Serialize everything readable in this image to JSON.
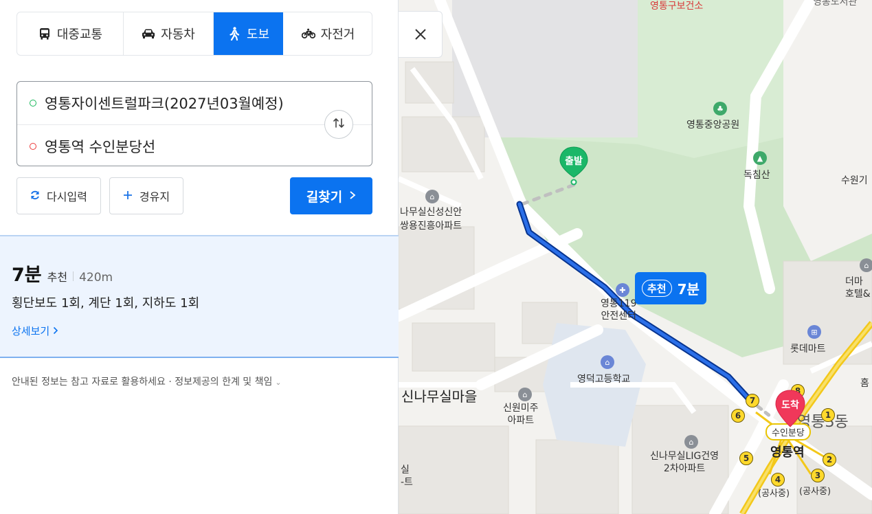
{
  "tabs": [
    {
      "label": "대중교통",
      "icon": "bus-icon"
    },
    {
      "label": "자동차",
      "icon": "car-icon"
    },
    {
      "label": "도보",
      "icon": "walk-icon",
      "active": true
    },
    {
      "label": "자전거",
      "icon": "bicycle-icon"
    }
  ],
  "route": {
    "origin": "영통자이센트럴파크(2027년03월예정)",
    "destination": "영통역 수인분당선"
  },
  "actions": {
    "reset": "다시입력",
    "waypoint": "경유지",
    "search": "길찾기"
  },
  "result": {
    "time": "7분",
    "badge": "추천",
    "distance": "420m",
    "summary": "횡단보도 1회, 계단 1회, 지하도 1회",
    "detail_link": "상세보기"
  },
  "notice": "안내된 정보는 참고 자료로 활용하세요 · 정보제공의 한계 및 책임",
  "map": {
    "start_pin": "출발",
    "end_pin": "도착",
    "route_badge": {
      "tag": "추천",
      "time": "7분"
    },
    "labels": {
      "bus_stop_top": "영통구보건소",
      "top_right": "영통도서관",
      "park": "영통중앙공원",
      "mountain": "독침산",
      "right_suwon": "수원기",
      "apt_shinan": "나무실신성신안",
      "apt_shinan2": "쌍용진흥아파트",
      "safety_center": "영통119\n안전센터",
      "hotel": "더마\n호텔&",
      "lotte": "롯데마트",
      "school": "영덕고등학교",
      "village": "신나무실마을",
      "apt_miju": "신원미주\n아파트",
      "apt_lig": "신나무실LIG건영\n2차아파트",
      "station": "영통역",
      "station_line": "수인분당",
      "dong": "영통3동",
      "construction1": "(공사중)",
      "construction2": "(공사중)",
      "edge_hom": "홈",
      "edge_bottom_left": "실\n-트"
    },
    "exits": [
      "1",
      "2",
      "3",
      "4",
      "5",
      "6",
      "7",
      "8"
    ]
  },
  "colors": {
    "accent": "#0b73f0",
    "start_pin": "#1bb768",
    "end_pin": "#f0385a",
    "route_line": "#0b5fd6"
  }
}
